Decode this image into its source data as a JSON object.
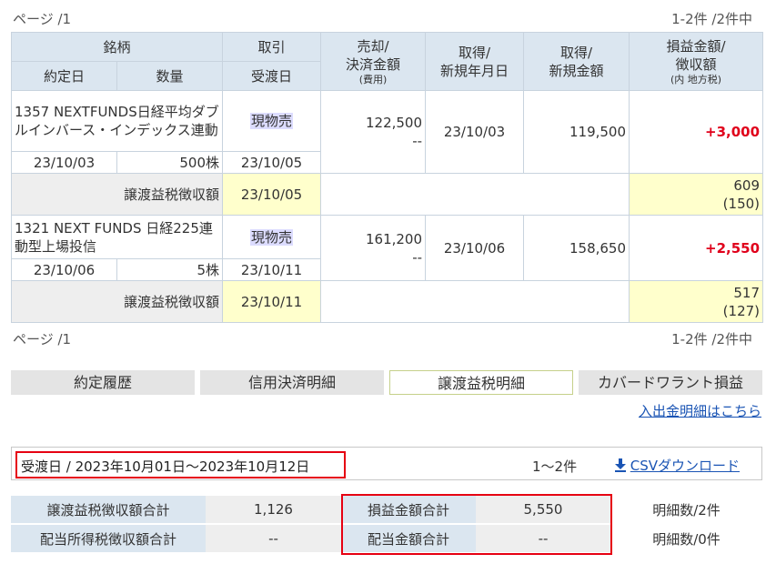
{
  "pager": {
    "top_left": "ページ /1",
    "top_right": "1-2件 /2件中",
    "bottom_left": "ページ /1",
    "bottom_right": "1-2件 /2件中"
  },
  "table_header": {
    "meigara": "銘柄",
    "torihiki": "取引",
    "yakujoubi": "約定日",
    "suuryou": "数量",
    "ukewatashibi": "受渡日",
    "baikyaku_line1": "売却/",
    "baikyaku_line2": "決済金額",
    "baikyaku_sub": "(費用)",
    "shutoku_date_line1": "取得/",
    "shutoku_date_line2": "新規年月日",
    "shutoku_amt_line1": "取得/",
    "shutoku_amt_line2": "新規金額",
    "soneki_line1": "損益金額/",
    "soneki_line2": "徴収額",
    "soneki_sub": "(内 地方税)"
  },
  "rows": [
    {
      "name": "1357 NEXTFUNDS日経平均ダブルインバース・インデックス連動",
      "torihiki": "現物売",
      "sell_amount": "122,500",
      "sell_fee": "--",
      "acq_date": "23/10/03",
      "acq_amount": "119,500",
      "pl": "+3,000",
      "yakujoubi": "23/10/03",
      "quantity": "500株",
      "ukewatashi": "23/10/05",
      "tax_label": "譲渡益税徴収額",
      "tax_date": "23/10/05",
      "tax_amount": "609",
      "tax_local": "(150)"
    },
    {
      "name": "1321 NEXT FUNDS 日経225連動型上場投信",
      "torihiki": "現物売",
      "sell_amount": "161,200",
      "sell_fee": "--",
      "acq_date": "23/10/06",
      "acq_amount": "158,650",
      "pl": "+2,550",
      "yakujoubi": "23/10/06",
      "quantity": "5株",
      "ukewatashi": "23/10/11",
      "tax_label": "譲渡益税徴収額",
      "tax_date": "23/10/11",
      "tax_amount": "517",
      "tax_local": "(127)"
    }
  ],
  "tabs": [
    {
      "label": "約定履歴",
      "active": false
    },
    {
      "label": "信用決済明細",
      "active": false
    },
    {
      "label": "譲渡益税明細",
      "active": true
    },
    {
      "label": "カバードワラント損益",
      "active": false
    }
  ],
  "links": {
    "cash_detail": "入出金明細はこちら",
    "csv_download": "CSVダウンロード"
  },
  "period": {
    "text": "受渡日 / 2023年10月01日〜2023年10月12日",
    "count": "1〜2件"
  },
  "summary": {
    "tax_total_label": "譲渡益税徴収額合計",
    "tax_total_value": "1,126",
    "pl_total_label": "損益金額合計",
    "pl_total_value": "5,550",
    "detail_count_1": "明細数/2件",
    "div_tax_label": "配当所得税徴収額合計",
    "div_tax_value": "--",
    "div_total_label": "配当金額合計",
    "div_total_value": "--",
    "detail_count_2": "明細数/0件"
  },
  "colors": {
    "header_bg": "#dbe6f0",
    "highlight_yellow": "#ffffcc",
    "profit_red": "#e0001b",
    "link_blue": "#1a54b4",
    "frame_red": "#e60012"
  }
}
